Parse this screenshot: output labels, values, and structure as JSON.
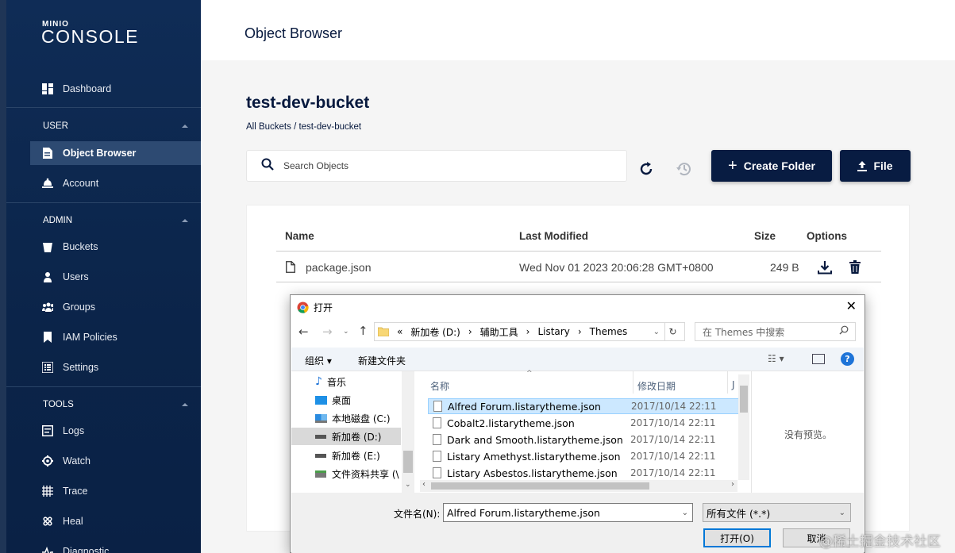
{
  "app": {
    "logo_small": "MINIO",
    "logo_big": "CONSOLE",
    "page_title": "Object Browser"
  },
  "sidebar": {
    "dashboard": "Dashboard",
    "user_section": "USER",
    "object_browser": "Object Browser",
    "account": "Account",
    "admin_section": "ADMIN",
    "buckets": "Buckets",
    "users": "Users",
    "groups": "Groups",
    "iam_policies": "IAM Policies",
    "settings": "Settings",
    "tools_section": "TOOLS",
    "logs": "Logs",
    "watch": "Watch",
    "trace": "Trace",
    "heal": "Heal",
    "diagnostic": "Diagnostic"
  },
  "bucket": {
    "name": "test-dev-bucket",
    "breadcrumb": "All Buckets / test-dev-bucket"
  },
  "toolbar": {
    "search_placeholder": "Search Objects",
    "create_folder": "Create Folder",
    "file": "File"
  },
  "table": {
    "headers": {
      "name": "Name",
      "modified": "Last Modified",
      "size": "Size",
      "options": "Options"
    },
    "rows": [
      {
        "name": "package.json",
        "modified": "Wed Nov 01 2023 20:06:28 GMT+0800",
        "size": "249 B"
      }
    ]
  },
  "dialog": {
    "title": "打开",
    "path": {
      "prefix": "«",
      "drive": "新加卷 (D:)",
      "folder1": "辅助工具",
      "folder2": "Listary",
      "folder3": "Themes"
    },
    "search_placeholder": "在 Themes 中搜索",
    "organize": "组织",
    "new_folder": "新建文件夹",
    "tree": [
      "音乐",
      "桌面",
      "本地磁盘 (C:)",
      "新加卷 (D:)",
      "新加卷 (E:)",
      "文件资料共享 (\\"
    ],
    "col_name": "名称",
    "col_date": "修改日期",
    "files": [
      {
        "name": "Alfred Forum.listarytheme.json",
        "date": "2017/10/14 22:11"
      },
      {
        "name": "Cobalt2.listarytheme.json",
        "date": "2017/10/14 22:11"
      },
      {
        "name": "Dark and Smooth.listarytheme.json",
        "date": "2017/10/14 22:11"
      },
      {
        "name": "Listary Amethyst.listarytheme.json",
        "date": "2017/10/14 22:11"
      },
      {
        "name": "Listary Asbestos.listarytheme.json",
        "date": "2017/10/14 22:11"
      }
    ],
    "col_type_partial": "J",
    "no_preview": "没有预览。",
    "filename_label": "文件名(N):",
    "filename_value": "Alfred Forum.listarytheme.json",
    "filter": "所有文件 (*.*)",
    "open_button": "打开(O)",
    "cancel_button": "取消"
  },
  "watermark": "@稀土掘金技术社区"
}
